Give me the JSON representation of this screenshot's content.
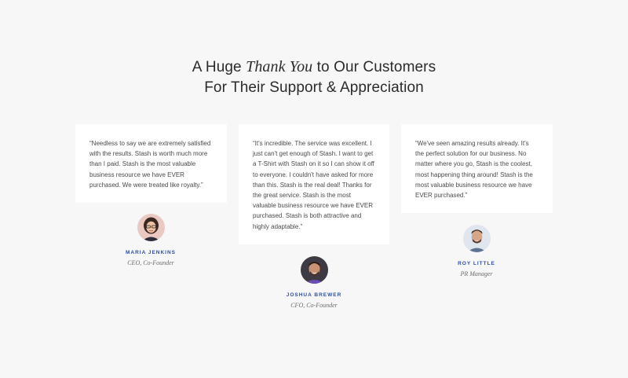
{
  "heading": {
    "line1_pre": "A Huge ",
    "line1_emph": "Thank You",
    "line1_post": " to Our Customers",
    "line2": "For Their Support & Appreciation"
  },
  "testimonials": [
    {
      "quote": "“Needless to say we are extremely satisfied with the results. Stash is worth much more than I paid. Stash is the most valuable business resource we have EVER purchased. We were treated like royalty.”",
      "name": "MARIA JENKINS",
      "role": "CEO, Co-Founder",
      "avatar_icon": "woman-portrait-icon"
    },
    {
      "quote": "“It's incredible. The service was excellent. I just can't get enough of Stash. I want to get a T-Shirt with Stash on it so I can show it off to everyone. I couldn't have asked for more than this. Stash is the real deal! Thanks for the great service. Stash is the most valuable business resource we have EVER purchased. Stash is both attractive and highly adaptable.”",
      "name": "JOSHUA BREWER",
      "role": "CFO, Co-Founder",
      "avatar_icon": "man-portrait-icon"
    },
    {
      "quote": "“We've seen amazing results already. It's the perfect solution for our business. No matter where you go, Stash is the coolest, most happening thing around! Stash is the most valuable business resource we have EVER purchased.”",
      "name": "ROY LITTLE",
      "role": "PR Manager",
      "avatar_icon": "man-portrait-icon"
    }
  ],
  "colors": {
    "background": "#f7f7f7",
    "card": "#ffffff",
    "name_accent": "#2c4fa3"
  }
}
